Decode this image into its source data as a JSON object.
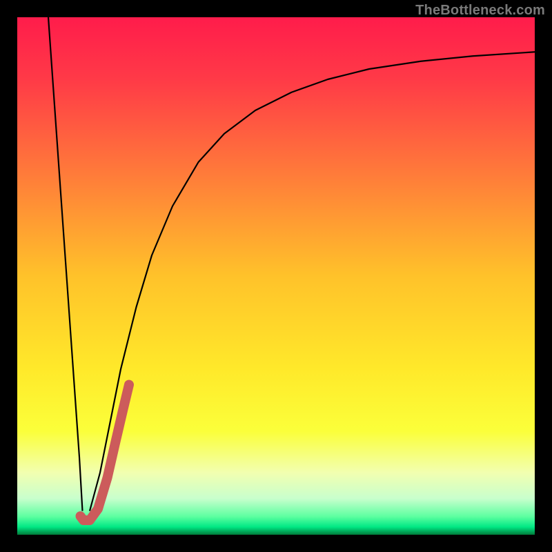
{
  "attribution": "TheBottleneck.com",
  "chart_data": {
    "type": "line",
    "title": "",
    "xlabel": "",
    "ylabel": "",
    "xlim": [
      0,
      100
    ],
    "ylim": [
      0,
      100
    ],
    "gradient_stops": [
      {
        "offset": 0.0,
        "color": "#ff1c4b"
      },
      {
        "offset": 0.12,
        "color": "#ff3a47"
      },
      {
        "offset": 0.3,
        "color": "#ff7a3a"
      },
      {
        "offset": 0.5,
        "color": "#ffc22a"
      },
      {
        "offset": 0.68,
        "color": "#ffe92a"
      },
      {
        "offset": 0.8,
        "color": "#fbff3a"
      },
      {
        "offset": 0.88,
        "color": "#f2ffb0"
      },
      {
        "offset": 0.93,
        "color": "#c8ffcd"
      },
      {
        "offset": 0.965,
        "color": "#5cffa0"
      },
      {
        "offset": 0.985,
        "color": "#00e884"
      },
      {
        "offset": 1.0,
        "color": "#007b3a"
      }
    ],
    "series": [
      {
        "name": "left-descent",
        "color": "#000000",
        "width": 2.2,
        "x": [
          6.0,
          7.2,
          8.4,
          9.6,
          10.8,
          12.0,
          12.6
        ],
        "y": [
          100.0,
          83.0,
          66.0,
          49.0,
          32.0,
          15.0,
          4.6
        ]
      },
      {
        "name": "right-ascent",
        "color": "#000000",
        "width": 2.2,
        "x": [
          14.0,
          16.0,
          18.0,
          20.0,
          23.0,
          26.0,
          30.0,
          35.0,
          40.0,
          46.0,
          53.0,
          60.0,
          68.0,
          78.0,
          88.0,
          100.0
        ],
        "y": [
          4.6,
          12.0,
          22.0,
          32.0,
          44.0,
          54.0,
          63.5,
          72.0,
          77.5,
          82.0,
          85.5,
          88.0,
          90.0,
          91.5,
          92.5,
          93.3
        ]
      },
      {
        "name": "highlight-hook",
        "color": "#cc5b5b",
        "width": 14,
        "linecap": "round",
        "x": [
          12.2,
          12.8,
          14.0,
          15.6,
          17.4,
          19.0,
          20.4,
          21.6
        ],
        "y": [
          3.6,
          2.8,
          2.8,
          5.0,
          11.0,
          18.0,
          24.0,
          29.0
        ]
      }
    ]
  }
}
